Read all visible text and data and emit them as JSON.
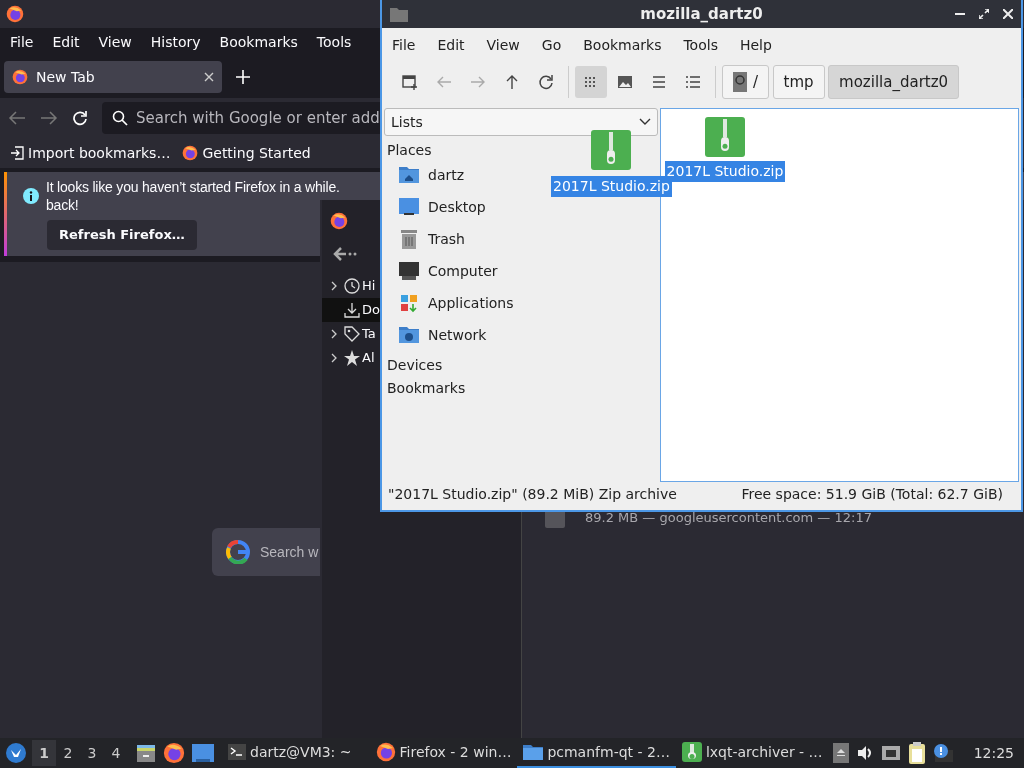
{
  "firefox": {
    "menu": [
      "File",
      "Edit",
      "View",
      "History",
      "Bookmarks",
      "Tools"
    ],
    "tab": {
      "title": "New Tab"
    },
    "address_placeholder": "Search with Google or enter add",
    "bookmarks": [
      {
        "kind": "import",
        "label": "Import bookmarks…"
      },
      {
        "kind": "site",
        "label": "Getting Started"
      }
    ],
    "notice": {
      "lines": [
        "It looks like you haven’t started Firefox in a while.",
        "back!"
      ],
      "button": "Refresh Firefox…"
    },
    "search_placeholder": "Search w"
  },
  "library": {
    "tree": [
      {
        "kind": "history",
        "label": "Hi",
        "expandable": true,
        "selected": false
      },
      {
        "kind": "downloads",
        "label": "Do",
        "expandable": false,
        "selected": true
      },
      {
        "kind": "tags",
        "label": "Ta",
        "expandable": true,
        "selected": false
      },
      {
        "kind": "all",
        "label": "Al",
        "expandable": true,
        "selected": false
      }
    ],
    "download": {
      "details": "89.2 MB — googleusercontent.com — 12:17"
    }
  },
  "file_manager": {
    "title": "mozilla_dartz0",
    "menu": [
      "File",
      "Edit",
      "View",
      "Go",
      "Bookmarks",
      "Tools",
      "Help"
    ],
    "view_modes": [
      {
        "kind": "icons",
        "selected": true
      },
      {
        "kind": "thumbnails",
        "selected": false
      },
      {
        "kind": "compact",
        "selected": false
      },
      {
        "kind": "details",
        "selected": false
      }
    ],
    "path": [
      {
        "kind": "root",
        "label": "/",
        "selected": false
      },
      {
        "kind": "dir",
        "label": "tmp",
        "selected": false
      },
      {
        "kind": "dir",
        "label": "mozilla_dartz0",
        "selected": true
      }
    ],
    "side_pane": {
      "view": "Lists",
      "sections": [
        {
          "title": "Places",
          "items": [
            {
              "kind": "home",
              "label": "dartz"
            },
            {
              "kind": "desktop",
              "label": "Desktop"
            },
            {
              "kind": "trash",
              "label": "Trash"
            },
            {
              "kind": "computer",
              "label": "Computer"
            },
            {
              "kind": "applications",
              "label": "Applications"
            },
            {
              "kind": "network",
              "label": "Network"
            }
          ]
        },
        {
          "title": "Devices"
        },
        {
          "title": "Bookmarks"
        }
      ]
    },
    "files": [
      {
        "name": "2017L Studio.zip",
        "selected": true
      }
    ],
    "drag": {
      "name": "2017L Studio.zip"
    },
    "status": {
      "selection": "\"2017L Studio.zip\" (89.2 MiB) Zip archive",
      "free_space": "Free space: 51.9 GiB (Total: 62.7 GiB)"
    }
  },
  "taskbar": {
    "workspaces": [
      {
        "label": "1",
        "selected": true
      },
      {
        "label": "2",
        "selected": false
      },
      {
        "label": "3",
        "selected": false
      },
      {
        "label": "4",
        "selected": false
      }
    ],
    "tasks": [
      {
        "kind": "terminal",
        "label": "dartz@VM3: ~",
        "active": false
      },
      {
        "kind": "firefox",
        "label": "Firefox - 2 win…",
        "active": false
      },
      {
        "kind": "folder",
        "label": "pcmanfm-qt - 2…",
        "active": true
      },
      {
        "kind": "archiver",
        "label": "lxqt-archiver - …",
        "active": false
      }
    ],
    "clock": "12:25"
  }
}
